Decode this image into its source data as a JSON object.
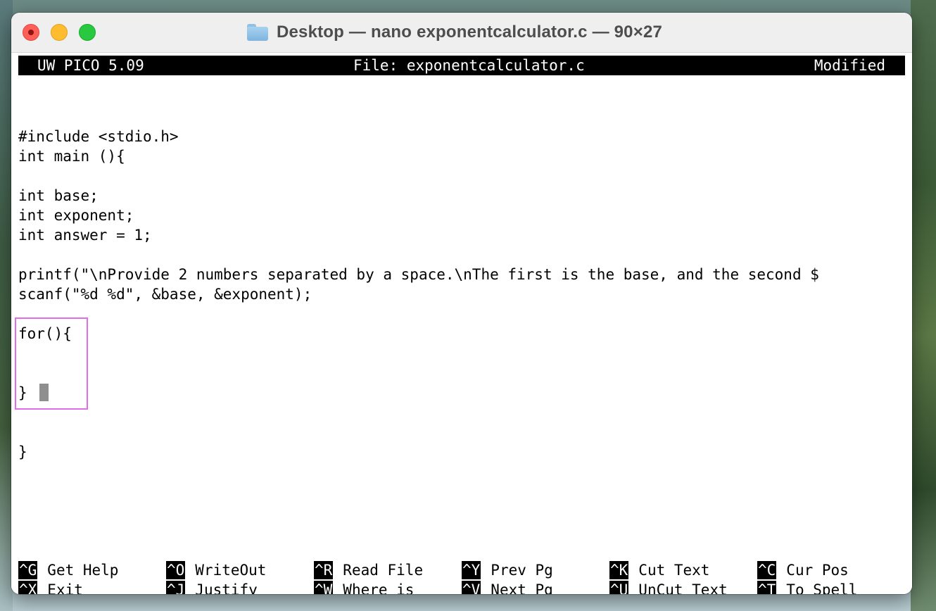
{
  "window": {
    "title": "Desktop — nano exponentcalculator.c — 90×27"
  },
  "editor": {
    "app": "UW PICO 5.09",
    "file": "File: exponentcalculator.c",
    "status": "Modified"
  },
  "code": {
    "lines": [
      "#include <stdio.h>",
      "int main (){",
      "int base;",
      "int exponent;",
      "int answer = 1;",
      "printf(\"\\nProvide 2 numbers separated by a space.\\nThe first is the base, and the second $",
      "scanf(\"%d %d\", &base, &exponent);",
      "for(){",
      "}",
      "}"
    ]
  },
  "shortcuts": [
    {
      "key": "^G",
      "label": "Get Help"
    },
    {
      "key": "^O",
      "label": "WriteOut"
    },
    {
      "key": "^R",
      "label": "Read File"
    },
    {
      "key": "^Y",
      "label": "Prev Pg"
    },
    {
      "key": "^K",
      "label": "Cut Text"
    },
    {
      "key": "^C",
      "label": "Cur Pos"
    },
    {
      "key": "^X",
      "label": "Exit"
    },
    {
      "key": "^J",
      "label": "Justify"
    },
    {
      "key": "^W",
      "label": "Where is"
    },
    {
      "key": "^V",
      "label": "Next Pg"
    },
    {
      "key": "^U",
      "label": "UnCut Text"
    },
    {
      "key": "^T",
      "label": "To Spell"
    }
  ],
  "colors": {
    "highlight_box": "#e36ce9",
    "close": "#ff5f57",
    "minimize": "#febc2e",
    "maximize": "#28c840"
  }
}
